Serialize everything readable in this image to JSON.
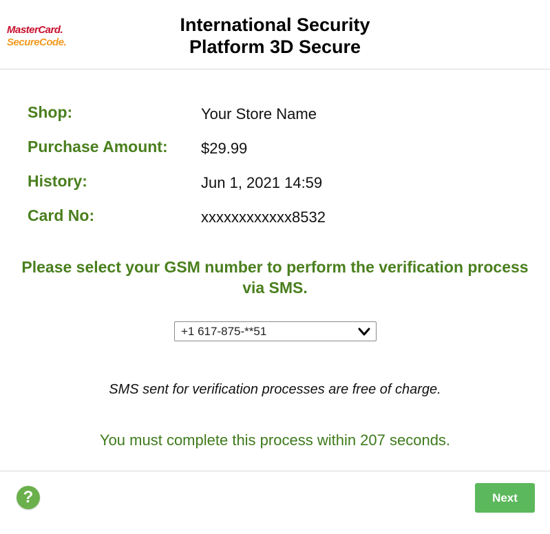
{
  "header": {
    "logo_line1": "MasterCard.",
    "logo_line2": "SecureCode.",
    "title_line1": "International Security",
    "title_line2": "Platform 3D Secure"
  },
  "details": [
    {
      "label": "Shop:",
      "value": "Your Store Name"
    },
    {
      "label": "Purchase Amount:",
      "value": "$29.99"
    },
    {
      "label": "History:",
      "value": "Jun 1, 2021 14:59"
    },
    {
      "label": "Card No:",
      "value": "xxxxxxxxxxxx8532"
    }
  ],
  "prompt": "Please select your GSM number to perform the verification process via SMS.",
  "gsm_select": {
    "selected": "+1 617-875-**51",
    "icon": "chevron-down-icon"
  },
  "note": "SMS sent for verification processes are free of charge.",
  "timer_text": "You must complete this process within 207 seconds.",
  "footer": {
    "help_icon": "question-icon",
    "help_glyph": "?",
    "next_label": "Next"
  },
  "colors": {
    "label_green": "#4a7f1e",
    "button_green": "#5cb85c",
    "help_green": "#6ab04c",
    "mastercard_red": "#c8102e",
    "securecode_orange": "#f39a1f"
  }
}
